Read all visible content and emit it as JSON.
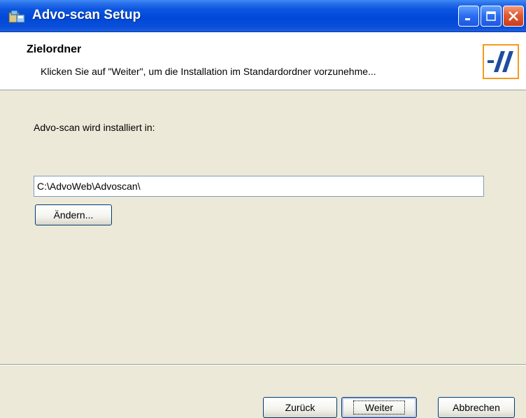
{
  "window": {
    "title": "Advo-scan Setup",
    "icons": {
      "app": "installer-icon",
      "minimize": "minimize-icon",
      "maximize": "maximize-icon",
      "close": "close-icon"
    },
    "colors": {
      "titlebar": "#0a55e0",
      "close": "#e25a33",
      "logo_border": "#f59a1c",
      "logo_mark": "#1f4d9e"
    }
  },
  "header": {
    "title": "Zielordner",
    "subtitle": "Klicken Sie auf \"Weiter\", um die Installation im Standardordner vorzunehme...",
    "logo_icon": "advoweb-logo-icon"
  },
  "content": {
    "install_label": "Advo-scan wird installiert in:",
    "path_value": "C:\\AdvoWeb\\Advoscan\\",
    "change_button": "Ändern..."
  },
  "buttons": {
    "back": "Zurück",
    "next": "Weiter",
    "cancel": "Abbrechen"
  }
}
